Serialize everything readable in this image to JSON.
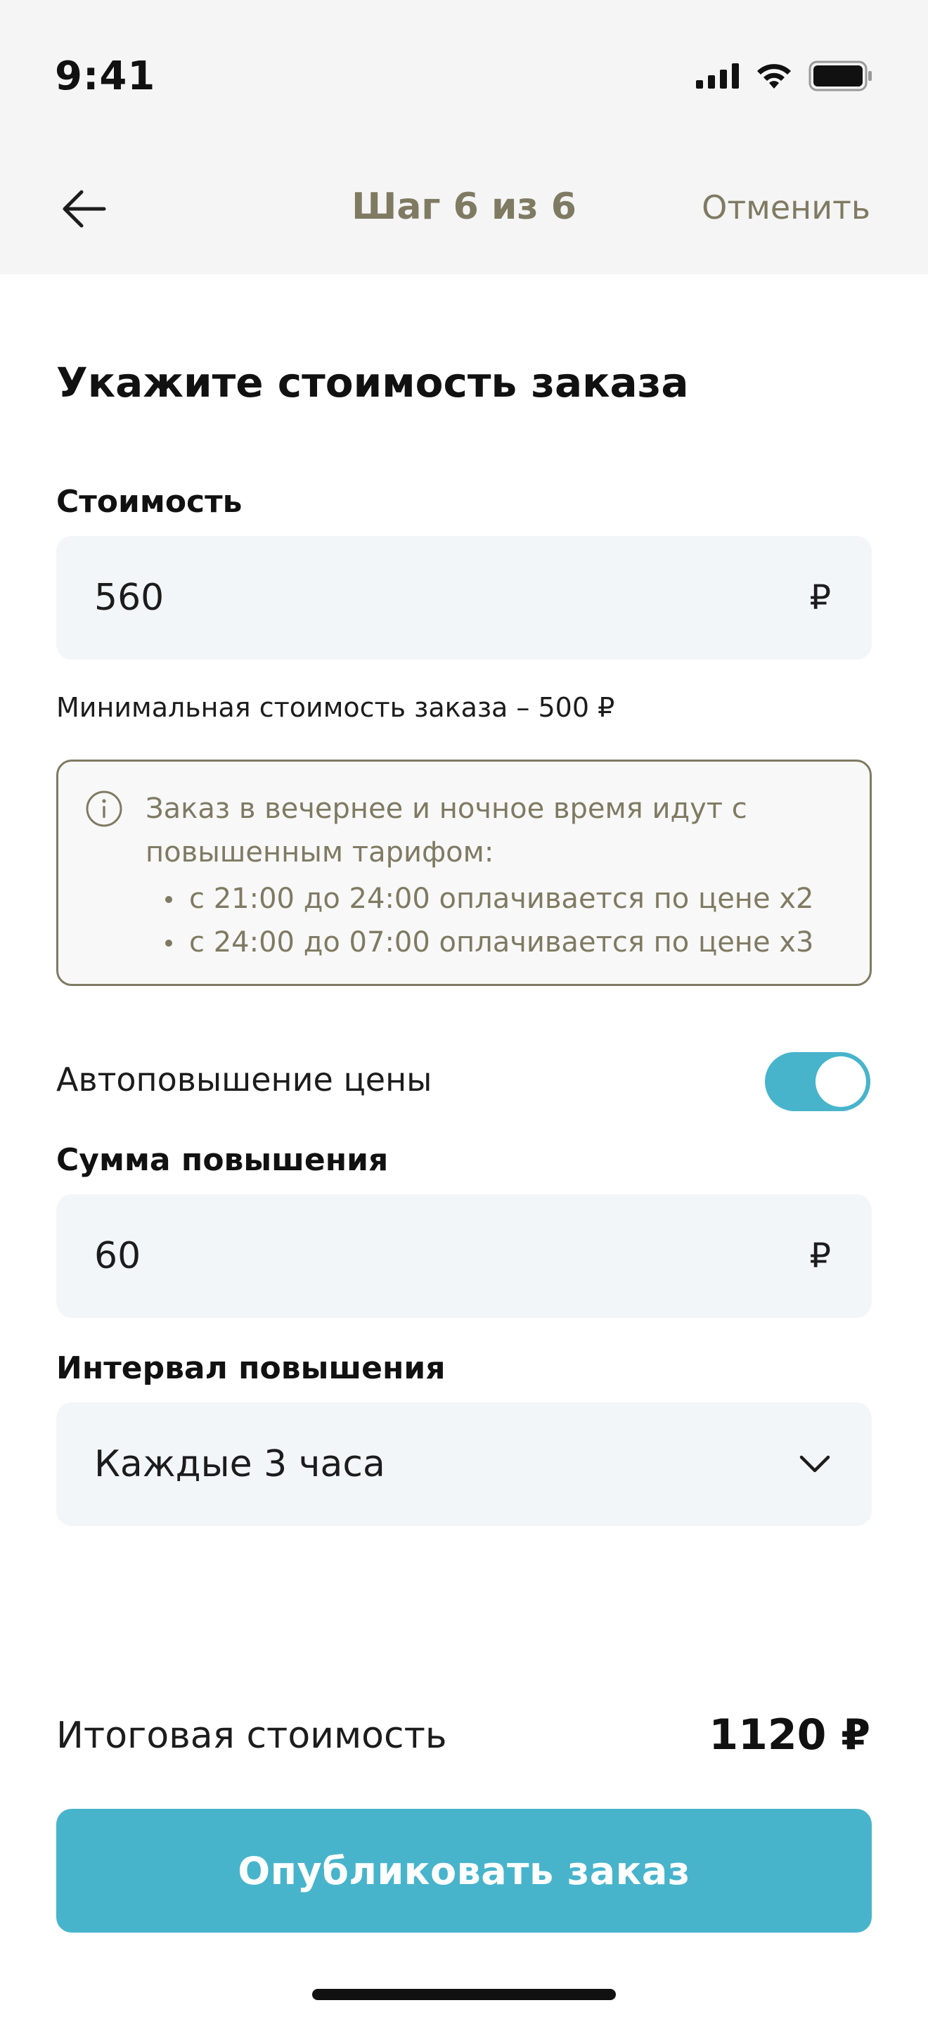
{
  "status_bar": {
    "time": "9:41"
  },
  "nav": {
    "title": "Шаг 6 из 6",
    "cancel_label": "Отменить"
  },
  "page": {
    "heading": "Укажите стоимость заказа"
  },
  "price": {
    "label": "Стоимость",
    "value": "560",
    "currency": "₽",
    "hint": "Минимальная стоимость заказа – 500 ₽"
  },
  "info": {
    "text": "Заказ в вечернее и ночное время идут с повышенным тарифом:",
    "items": [
      "с 21:00 до 24:00 оплачивается по цене х2",
      "с 24:00 до 07:00 оплачивается по цене х3"
    ]
  },
  "auto_raise": {
    "label": "Автоповышение цены",
    "enabled": true
  },
  "raise_amount": {
    "label": "Сумма повышения",
    "value": "60",
    "currency": "₽"
  },
  "raise_interval": {
    "label": "Интервал повышения",
    "value": "Каждые 3 часа"
  },
  "total": {
    "label": "Итоговая стоимость",
    "value": "1120 ₽"
  },
  "publish": {
    "label": "Опубликовать заказ"
  },
  "colors": {
    "accent": "#47b4cc",
    "muted": "#7f7a62",
    "field_bg": "#f3f6f9",
    "header_bg": "#f5f5f5"
  }
}
